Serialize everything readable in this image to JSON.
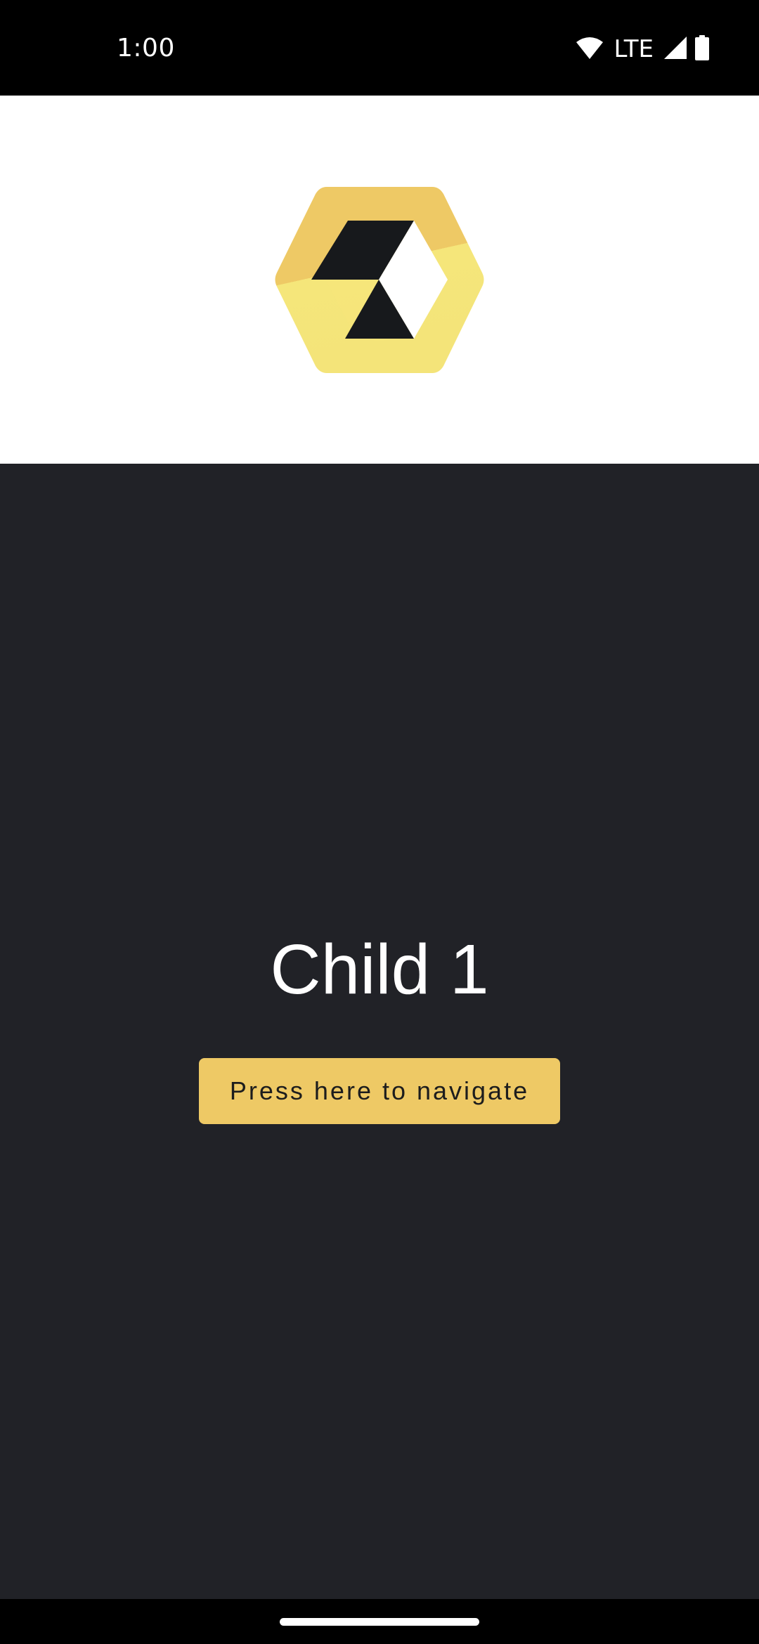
{
  "status_bar": {
    "time": "1:00",
    "network": "LTE",
    "icons": [
      "wifi-icon",
      "signal-icon",
      "battery-icon"
    ]
  },
  "header": {
    "logo": "hexagon-logo",
    "colors": {
      "hex_gold": "#EEC965",
      "hex_light": "#F5E67A",
      "cube_dark": "#17191C"
    }
  },
  "content": {
    "title": "Child 1",
    "button_label": "Press here to navigate",
    "colors": {
      "background": "#212227",
      "button": "#EEC965"
    }
  }
}
